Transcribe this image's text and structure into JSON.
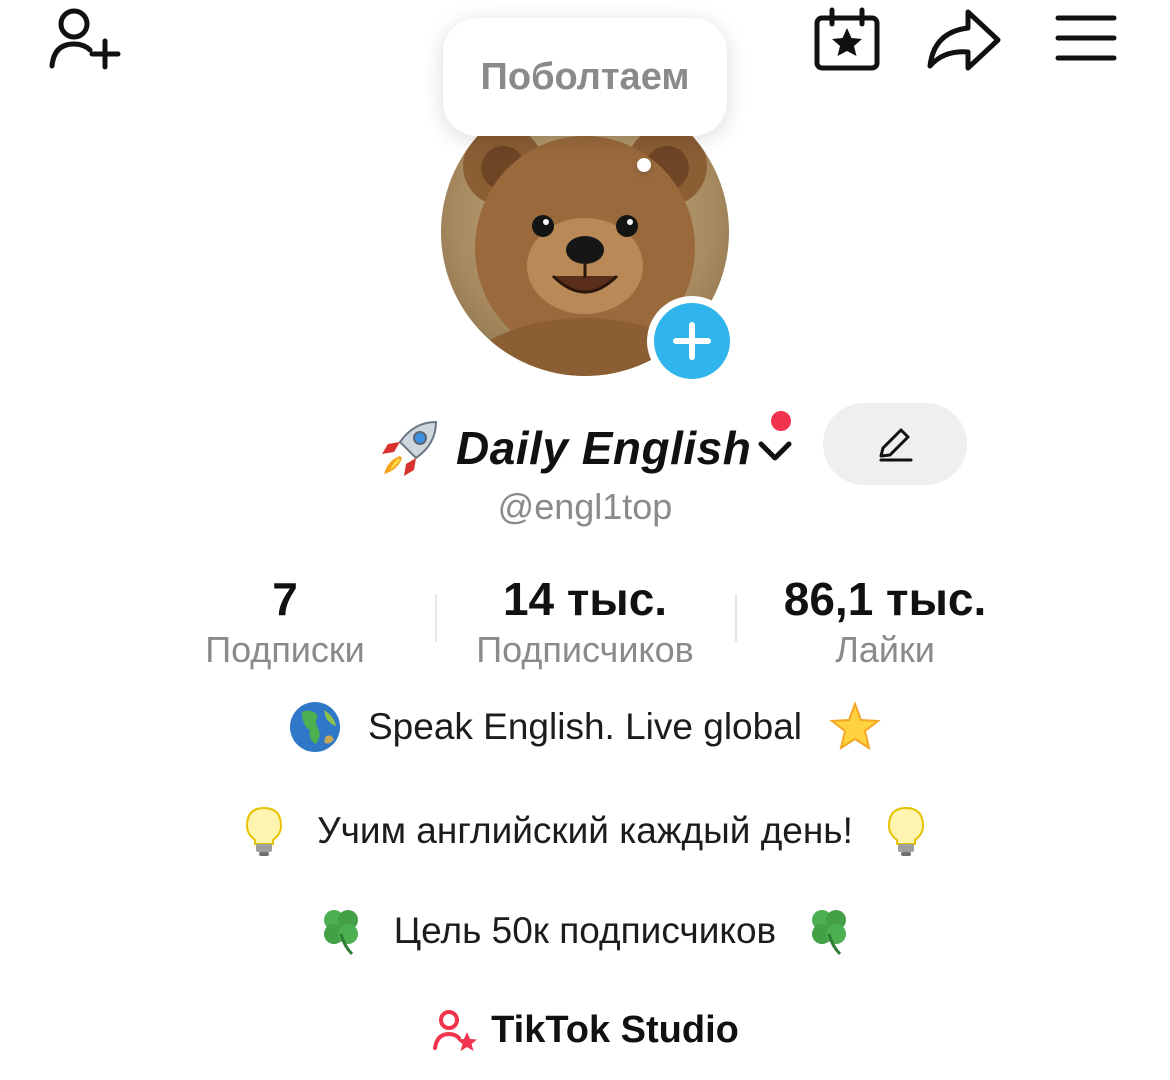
{
  "bubble": {
    "text": "Поболтаем"
  },
  "profile": {
    "display_name": "Daily English",
    "username": "@engl1top"
  },
  "stats": [
    {
      "value": "7",
      "label": "Подписки"
    },
    {
      "value": "14 тыс.",
      "label": "Подписчиков"
    },
    {
      "value": "86,1 тыс.",
      "label": "Лайки"
    }
  ],
  "bio": {
    "line1": "Speak English. Live global",
    "line2": "Учим английский каждый день!",
    "line3": "Цель 50к подписчиков"
  },
  "studio": {
    "label": "TikTok Studio"
  },
  "colors": {
    "accent_red": "#f0344d",
    "add_blue": "#2fb4ec",
    "muted_text": "#8a8a8a"
  },
  "icons": [
    "add-friend-icon",
    "calendar-star-icon",
    "share-icon",
    "menu-icon",
    "rocket-icon",
    "chevron-down-icon",
    "edit-pencil-icon",
    "globe-icon",
    "star-icon",
    "lightbulb-icon",
    "clover-icon",
    "studio-icon"
  ]
}
